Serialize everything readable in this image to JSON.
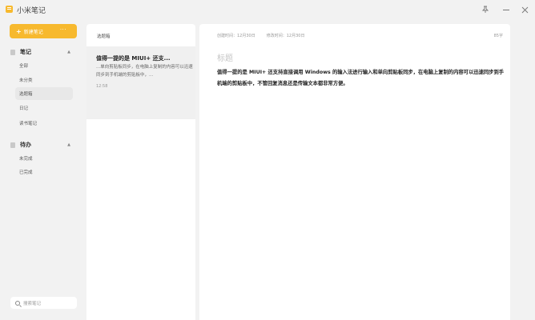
{
  "app": {
    "title": "小米笔记",
    "accent": "#f7b92e"
  },
  "window": {
    "pin_icon": "pin-icon",
    "minimize_icon": "minimize-icon",
    "close_icon": "close-icon"
  },
  "sidebar": {
    "new_note_label": "新建笔记",
    "more_label": "···",
    "notes_group": {
      "label": "笔记",
      "items": [
        "全部",
        "未分类",
        "选题箱",
        "日记",
        "读书笔记"
      ],
      "selected": "选题箱"
    },
    "todo_group": {
      "label": "待办",
      "items": [
        "未完成",
        "已完成"
      ]
    },
    "search_placeholder": "搜索笔记"
  },
  "list": {
    "title": "选题箱",
    "notes": [
      {
        "title": "值得一提的是 MIUI+ 还支...",
        "preview": "...单向剪贴板同步，在电脑上复制的内容可以迅速同步到手机端的剪贴板中，...",
        "time": "12:58"
      }
    ]
  },
  "editor": {
    "created": "创建时间：12月30日",
    "modified": "修改时间：12月30日",
    "word_count": "85字",
    "title_placeholder": "标题",
    "body": "值得一提的是 MIUI+ 还支持直接调用 Windows 的输入法进行输入和单向剪贴板同步，在电脑上复制的内容可以迅速同步到手机端的剪贴板中，不管回复消息还是传输文本都非常方便。"
  }
}
